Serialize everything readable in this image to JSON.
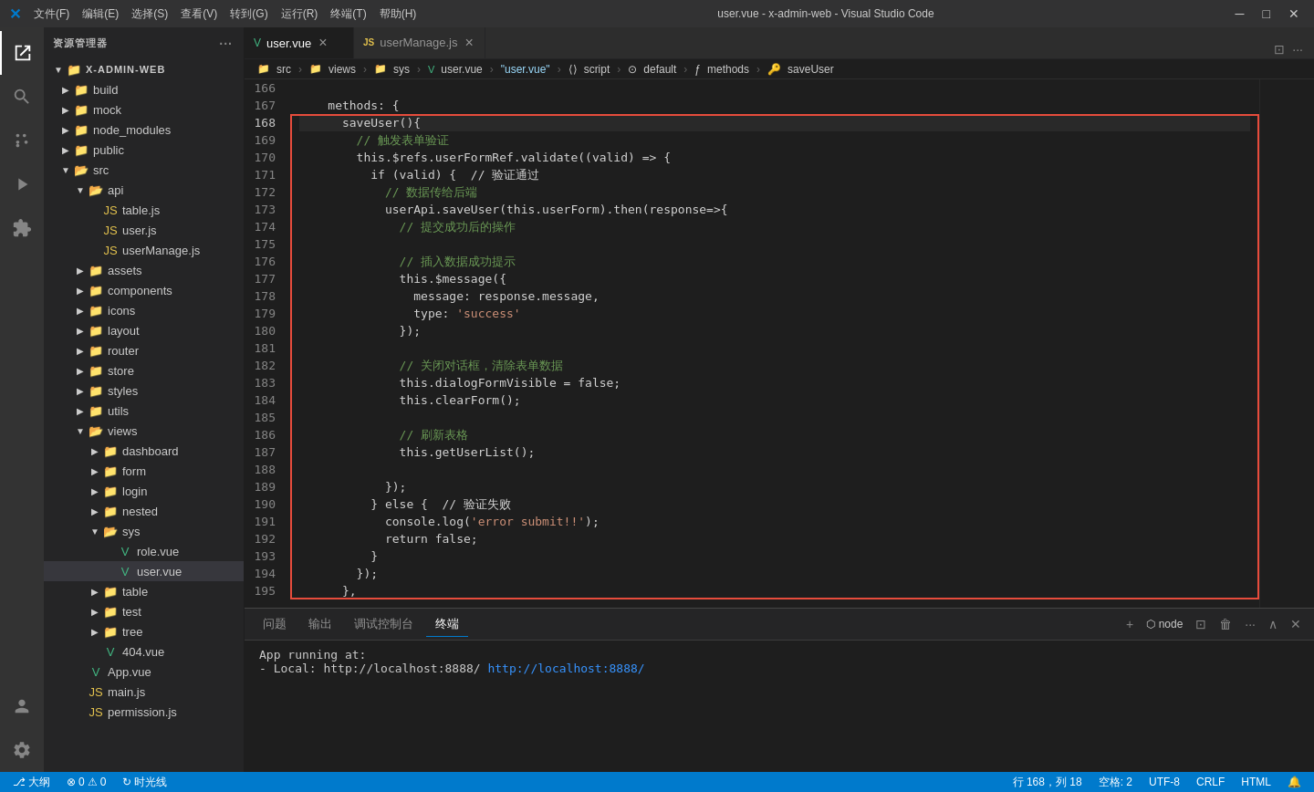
{
  "titleBar": {
    "icon": "VS",
    "menus": [
      "文件(F)",
      "编辑(E)",
      "选择(S)",
      "查看(V)",
      "转到(G)",
      "运行(R)",
      "终端(T)",
      "帮助(H)"
    ],
    "title": "user.vue - x-admin-web - Visual Studio Code",
    "windowControls": [
      "⬜",
      "❐",
      "✕"
    ]
  },
  "activityBar": {
    "items": [
      "explorer",
      "search",
      "source-control",
      "run-debug",
      "extensions"
    ],
    "icons": [
      "⧉",
      "🔍",
      "⎇",
      "▷",
      "⊞"
    ],
    "bottomItems": [
      "account",
      "settings"
    ],
    "bottomIcons": [
      "👤",
      "⚙"
    ]
  },
  "sidebar": {
    "title": "资源管理器",
    "moreIcon": "···",
    "rootName": "X-ADMIN-WEB",
    "tree": [
      {
        "label": "build",
        "type": "folder",
        "indent": 1,
        "expanded": false
      },
      {
        "label": "mock",
        "type": "folder",
        "indent": 1,
        "expanded": false
      },
      {
        "label": "node_modules",
        "type": "folder",
        "indent": 1,
        "expanded": false
      },
      {
        "label": "public",
        "type": "folder",
        "indent": 1,
        "expanded": false
      },
      {
        "label": "src",
        "type": "folder",
        "indent": 1,
        "expanded": true
      },
      {
        "label": "api",
        "type": "folder",
        "indent": 2,
        "expanded": true
      },
      {
        "label": "table.js",
        "type": "js",
        "indent": 3
      },
      {
        "label": "user.js",
        "type": "js",
        "indent": 3
      },
      {
        "label": "userManage.js",
        "type": "js",
        "indent": 3
      },
      {
        "label": "assets",
        "type": "folder",
        "indent": 2,
        "expanded": false
      },
      {
        "label": "components",
        "type": "folder",
        "indent": 2,
        "expanded": false
      },
      {
        "label": "icons",
        "type": "folder",
        "indent": 2,
        "expanded": false
      },
      {
        "label": "layout",
        "type": "folder",
        "indent": 2,
        "expanded": false
      },
      {
        "label": "router",
        "type": "folder",
        "indent": 2,
        "expanded": false
      },
      {
        "label": "store",
        "type": "folder",
        "indent": 2,
        "expanded": false
      },
      {
        "label": "styles",
        "type": "folder",
        "indent": 2,
        "expanded": false
      },
      {
        "label": "utils",
        "type": "folder",
        "indent": 2,
        "expanded": false
      },
      {
        "label": "views",
        "type": "folder",
        "indent": 2,
        "expanded": true
      },
      {
        "label": "dashboard",
        "type": "folder",
        "indent": 3,
        "expanded": false
      },
      {
        "label": "form",
        "type": "folder",
        "indent": 3,
        "expanded": false
      },
      {
        "label": "login",
        "type": "folder",
        "indent": 3,
        "expanded": false
      },
      {
        "label": "nested",
        "type": "folder",
        "indent": 3,
        "expanded": false
      },
      {
        "label": "sys",
        "type": "folder",
        "indent": 3,
        "expanded": true
      },
      {
        "label": "role.vue",
        "type": "vue",
        "indent": 4
      },
      {
        "label": "user.vue",
        "type": "vue",
        "indent": 4,
        "active": true
      },
      {
        "label": "table",
        "type": "folder",
        "indent": 3,
        "expanded": false
      },
      {
        "label": "test",
        "type": "folder",
        "indent": 3,
        "expanded": false
      },
      {
        "label": "tree",
        "type": "folder",
        "indent": 3,
        "expanded": false
      },
      {
        "label": "404.vue",
        "type": "vue",
        "indent": 3
      },
      {
        "label": "App.vue",
        "type": "vue",
        "indent": 2
      },
      {
        "label": "main.js",
        "type": "js",
        "indent": 2
      },
      {
        "label": "permission.js",
        "type": "js",
        "indent": 2
      }
    ]
  },
  "tabs": [
    {
      "label": "user.vue",
      "type": "vue",
      "active": true,
      "modified": false
    },
    {
      "label": "userManage.js",
      "type": "js",
      "active": false,
      "modified": false
    }
  ],
  "breadcrumb": {
    "items": [
      "src",
      "views",
      "sys",
      "user.vue",
      "\"user.vue\"",
      "script",
      "default",
      "methods",
      "saveUser"
    ]
  },
  "codeLines": [
    {
      "num": 166,
      "tokens": []
    },
    {
      "num": 167,
      "tokens": [
        {
          "t": "    methods: {",
          "c": "tx"
        }
      ]
    },
    {
      "num": 168,
      "tokens": [
        {
          "t": "      saveUser(){",
          "c": "tx"
        }
      ],
      "highlighted": true
    },
    {
      "num": 169,
      "tokens": [
        {
          "t": "        // 触发表单验证",
          "c": "cm"
        }
      ]
    },
    {
      "num": 170,
      "tokens": [
        {
          "t": "        this.$refs.userFormRef.validate((valid) => {",
          "c": "tx"
        }
      ]
    },
    {
      "num": 171,
      "tokens": [
        {
          "t": "          if (valid) {  // 验证通过",
          "c": "tx"
        }
      ]
    },
    {
      "num": 172,
      "tokens": [
        {
          "t": "            // 数据传给后端",
          "c": "cm"
        }
      ]
    },
    {
      "num": 173,
      "tokens": [
        {
          "t": "            userApi.saveUser(this.userForm).then(response=>{",
          "c": "tx"
        }
      ]
    },
    {
      "num": 174,
      "tokens": [
        {
          "t": "              // 提交成功后的操作",
          "c": "cm"
        }
      ]
    },
    {
      "num": 175,
      "tokens": []
    },
    {
      "num": 176,
      "tokens": [
        {
          "t": "              // 插入数据成功提示",
          "c": "cm"
        }
      ]
    },
    {
      "num": 177,
      "tokens": [
        {
          "t": "              this.$message({",
          "c": "tx"
        }
      ]
    },
    {
      "num": 178,
      "tokens": [
        {
          "t": "                message: response.message,",
          "c": "tx"
        }
      ]
    },
    {
      "num": 179,
      "tokens": [
        {
          "t": "                type: ",
          "c": "tx"
        },
        {
          "t": "'success'",
          "c": "st"
        }
      ]
    },
    {
      "num": 180,
      "tokens": [
        {
          "t": "              });",
          "c": "tx"
        }
      ]
    },
    {
      "num": 181,
      "tokens": []
    },
    {
      "num": 182,
      "tokens": [
        {
          "t": "              // 关闭对话框，清除表单数据",
          "c": "cm"
        }
      ]
    },
    {
      "num": 183,
      "tokens": [
        {
          "t": "              this.dialogFormVisible = false;",
          "c": "tx"
        }
      ]
    },
    {
      "num": 184,
      "tokens": [
        {
          "t": "              this.clearForm();",
          "c": "tx"
        }
      ]
    },
    {
      "num": 185,
      "tokens": []
    },
    {
      "num": 186,
      "tokens": [
        {
          "t": "              // 刷新表格",
          "c": "cm"
        }
      ]
    },
    {
      "num": 187,
      "tokens": [
        {
          "t": "              this.getUserList();",
          "c": "tx"
        }
      ]
    },
    {
      "num": 188,
      "tokens": []
    },
    {
      "num": 189,
      "tokens": [
        {
          "t": "            });",
          "c": "tx"
        }
      ]
    },
    {
      "num": 190,
      "tokens": [
        {
          "t": "          } else {  // 验证失败",
          "c": "tx"
        }
      ]
    },
    {
      "num": 191,
      "tokens": [
        {
          "t": "            console.log(",
          "c": "tx"
        },
        {
          "t": "'error submit!!'",
          "c": "st"
        },
        {
          "t": ");",
          "c": "tx"
        }
      ]
    },
    {
      "num": 192,
      "tokens": [
        {
          "t": "            return false;",
          "c": "tx"
        }
      ]
    },
    {
      "num": 193,
      "tokens": [
        {
          "t": "          }",
          "c": "tx"
        }
      ]
    },
    {
      "num": 194,
      "tokens": [
        {
          "t": "        });",
          "c": "tx"
        }
      ]
    },
    {
      "num": 195,
      "tokens": [
        {
          "t": "      },",
          "c": "tx"
        }
      ]
    }
  ],
  "panel": {
    "tabs": [
      "问题",
      "输出",
      "调试控制台",
      "终端"
    ],
    "activeTab": "终端",
    "content": [
      "App running at:",
      "  - Local:   http://localhost:8888/"
    ],
    "localUrl": "http://localhost:8888/"
  },
  "statusBar": {
    "left": [
      "⎇ 大纲",
      "↻ 时光线"
    ],
    "errors": "0",
    "warnings": "0",
    "position": "行 168，列 18",
    "spaces": "空格: 2",
    "encoding": "UTF-8",
    "lineEnding": "CRLF",
    "language": "HTML"
  }
}
